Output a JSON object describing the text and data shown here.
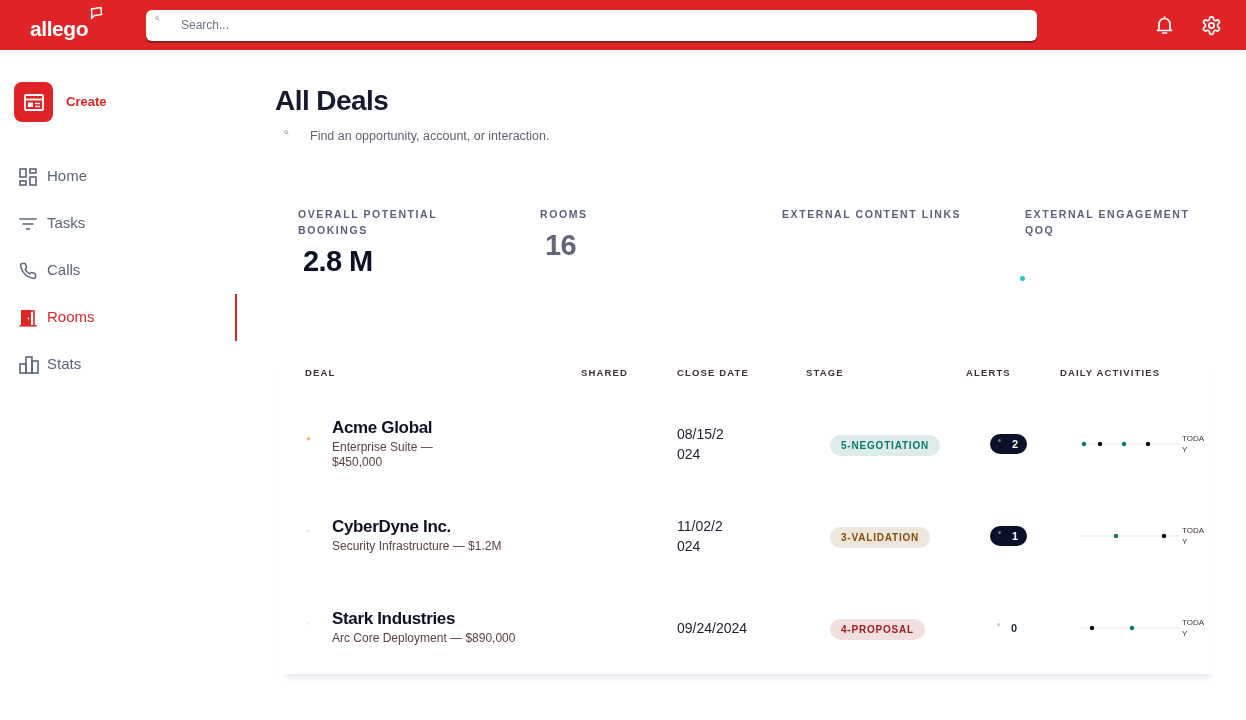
{
  "header": {
    "logo": "allego",
    "search": {
      "placeholder": "Search..."
    }
  },
  "sidebar": {
    "create": "Create",
    "items": [
      {
        "label": "Home",
        "selected": false
      },
      {
        "label": "Tasks",
        "selected": false
      },
      {
        "label": "Calls",
        "selected": false
      },
      {
        "label": "Rooms",
        "selected": true
      },
      {
        "label": "Stats",
        "selected": false
      }
    ]
  },
  "page": {
    "title": "All Deals",
    "subtitle": "Find an opportunity, account, or interaction."
  },
  "metrics": [
    {
      "label": "OVERALL POTENTIAL BOOKINGS",
      "kind": "number",
      "value": "2.8 M",
      "muted": false
    },
    {
      "label": "ROOMS",
      "kind": "number",
      "value": "16",
      "muted": true
    },
    {
      "label": "EXTERNAL CONTENT LINKS",
      "kind": "empty"
    },
    {
      "label": "EXTERNAL ENGAGEMENT QOQ",
      "kind": "sparkline"
    }
  ],
  "deals": {
    "columns": [
      "DEAL",
      "SHARED",
      "CLOSE DATE",
      "STAGE",
      "ALERTS",
      "DAILY ACTIVITIES"
    ],
    "rows": [
      {
        "starred": true,
        "name": "Acme Global",
        "subtitle_lines": [
          "Enterprise Suite —",
          "$450,000"
        ],
        "close_date_lines": [
          "08/15/2",
          "024"
        ],
        "stage": {
          "label": "5-NEGOTIATION",
          "color": "#0f766e"
        },
        "alerts": {
          "count": "2",
          "active": true
        },
        "days": [
          {
            "kind": "dot",
            "color": "#0f766e"
          },
          {
            "kind": "blank"
          },
          {
            "kind": "dot",
            "color": "#111111"
          },
          {
            "kind": "blank"
          },
          {
            "kind": "blank"
          },
          {
            "kind": "dot",
            "color": "#0f766e"
          },
          {
            "kind": "blank"
          },
          {
            "kind": "blank"
          },
          {
            "kind": "dot",
            "color": "#111111"
          },
          {
            "kind": "blank"
          },
          {
            "kind": "blank"
          },
          {
            "kind": "blank"
          }
        ],
        "today_lines": [
          "TODA",
          "Y"
        ]
      },
      {
        "starred": false,
        "name": "CyberDyne Inc.",
        "subtitle_lines": [
          "Security Infrastructure — $1.2M"
        ],
        "close_date_lines": [
          "11/02/2",
          "024"
        ],
        "stage": {
          "label": "3-VALIDATION",
          "color": "#854d0e"
        },
        "alerts": {
          "count": "1",
          "active": true
        },
        "days": [
          {
            "kind": "blank"
          },
          {
            "kind": "blank"
          },
          {
            "kind": "blank"
          },
          {
            "kind": "blank"
          },
          {
            "kind": "dot",
            "color": "#0f766e"
          },
          {
            "kind": "blank"
          },
          {
            "kind": "blank"
          },
          {
            "kind": "blank"
          },
          {
            "kind": "blank"
          },
          {
            "kind": "blank"
          },
          {
            "kind": "dot",
            "color": "#111111"
          },
          {
            "kind": "blank"
          }
        ],
        "today_lines": [
          "TODA",
          "Y"
        ]
      },
      {
        "starred": false,
        "name": "Stark Industries",
        "subtitle_lines": [
          "Arc Core Deployment — $890,000"
        ],
        "close_date_lines": [
          "09/24/2024"
        ],
        "stage": {
          "label": "4-PROPOSAL",
          "color": "#991b1b"
        },
        "alerts": {
          "count": "0",
          "active": false
        },
        "days": [
          {
            "kind": "blank"
          },
          {
            "kind": "dot",
            "color": "#111111"
          },
          {
            "kind": "blank"
          },
          {
            "kind": "blank"
          },
          {
            "kind": "blank"
          },
          {
            "kind": "blank"
          },
          {
            "kind": "dot",
            "color": "#0f766e"
          },
          {
            "kind": "blank"
          },
          {
            "kind": "blank"
          },
          {
            "kind": "blank"
          },
          {
            "kind": "blank"
          },
          {
            "kind": "blank"
          }
        ],
        "today_lines": [
          "TODA",
          "Y"
        ]
      }
    ]
  }
}
